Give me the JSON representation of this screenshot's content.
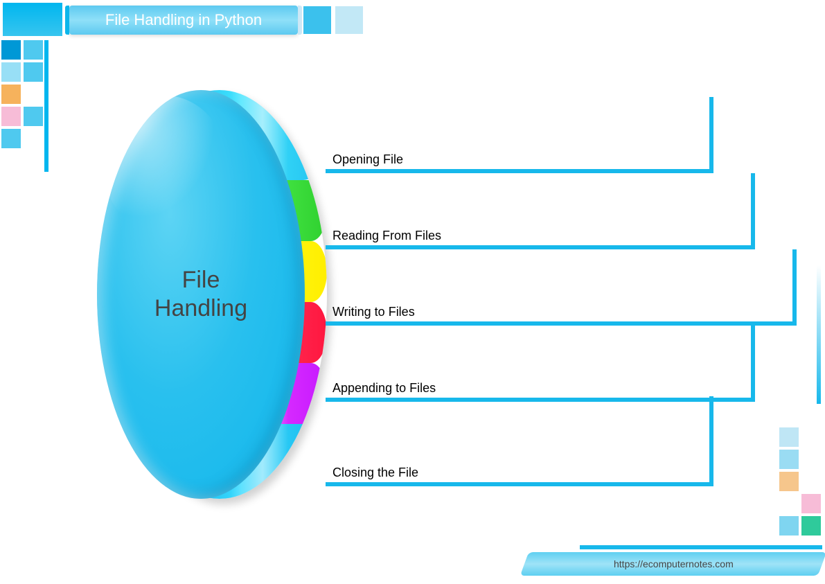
{
  "header": {
    "title": "File Handling in Python"
  },
  "disc": {
    "center_label_line1": "File",
    "center_label_line2": "Handling"
  },
  "branches": [
    {
      "label": "Opening File"
    },
    {
      "label": "Reading From Files"
    },
    {
      "label": "Writing to Files"
    },
    {
      "label": "Appending to Files"
    },
    {
      "label": "Closing the File"
    }
  ],
  "footer": {
    "url": "https://ecomputernotes.com"
  },
  "colors": {
    "accent": "#17b8eb",
    "deco_top_left": [
      "#0098d6",
      "#4fc9ef",
      "#98dff6",
      "#4fc9ef",
      "#f6b25c",
      "#ffffff",
      "#f7bcd7",
      "#4fc9ef",
      "#4fc9ef",
      "#ffffff"
    ],
    "deco_bottom_right": [
      "#bfe6f5",
      "#ffffff",
      "#9adcf3",
      "#ffffff",
      "#f6c68c",
      "#ffffff",
      "#ffffff",
      "#f7bcd7",
      "#7fd5f0",
      "#2fca9b"
    ],
    "edge_stripes": [
      "#20c1ee",
      "#2fd02f",
      "#ffee00",
      "#ff173f",
      "#c619ff",
      "#17b8eb"
    ]
  }
}
